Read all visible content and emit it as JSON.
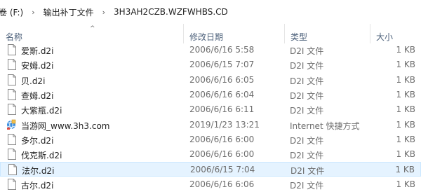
{
  "breadcrumb": {
    "items": [
      "卷 (F:)",
      "输出补丁文件",
      "3H3AH2CZB.WZFWHBS.CD"
    ],
    "separator": "›"
  },
  "columns": {
    "name": "名称",
    "date": "修改日期",
    "type": "类型",
    "size": "大小",
    "sort_indicator": "^"
  },
  "files": [
    {
      "name": "爱斯.d2i",
      "date": "2006/6/16 5:58",
      "type": "D2I 文件",
      "size": "1 KB",
      "icon": "file-icon"
    },
    {
      "name": "安姆.d2i",
      "date": "2006/6/15 7:07",
      "type": "D2I 文件",
      "size": "1 KB",
      "icon": "file-icon"
    },
    {
      "name": "贝.d2i",
      "date": "2006/6/16 6:05",
      "type": "D2I 文件",
      "size": "1 KB",
      "icon": "file-icon"
    },
    {
      "name": "查姆.d2i",
      "date": "2006/6/16 6:04",
      "type": "D2I 文件",
      "size": "1 KB",
      "icon": "file-icon"
    },
    {
      "name": "大紫瓶.d2i",
      "date": "2006/6/16 6:11",
      "type": "D2I 文件",
      "size": "1 KB",
      "icon": "file-icon"
    },
    {
      "name": "当游网_www.3h3.com",
      "date": "2019/1/23 13:21",
      "type": "Internet 快捷方式",
      "size": "1 KB",
      "icon": "internet-shortcut-icon"
    },
    {
      "name": "多尔.d2i",
      "date": "2006/6/16 6:00",
      "type": "D2I 文件",
      "size": "1 KB",
      "icon": "file-icon"
    },
    {
      "name": "伐克斯.d2i",
      "date": "2006/6/16 6:00",
      "type": "D2I 文件",
      "size": "1 KB",
      "icon": "file-icon"
    },
    {
      "name": "法尔.d2i",
      "date": "2006/6/15 7:04",
      "type": "D2I 文件",
      "size": "1 KB",
      "icon": "file-icon",
      "selected": true
    },
    {
      "name": "古尔.d2i",
      "date": "2006/6/16 6:06",
      "type": "D2I 文件",
      "size": "1 KB",
      "icon": "file-icon"
    }
  ],
  "colors": {
    "selection_bg": "#e5f3ff",
    "selection_border": "#cce8ff",
    "header_text": "#4c607a",
    "secondary_text": "#6d6d6d"
  }
}
